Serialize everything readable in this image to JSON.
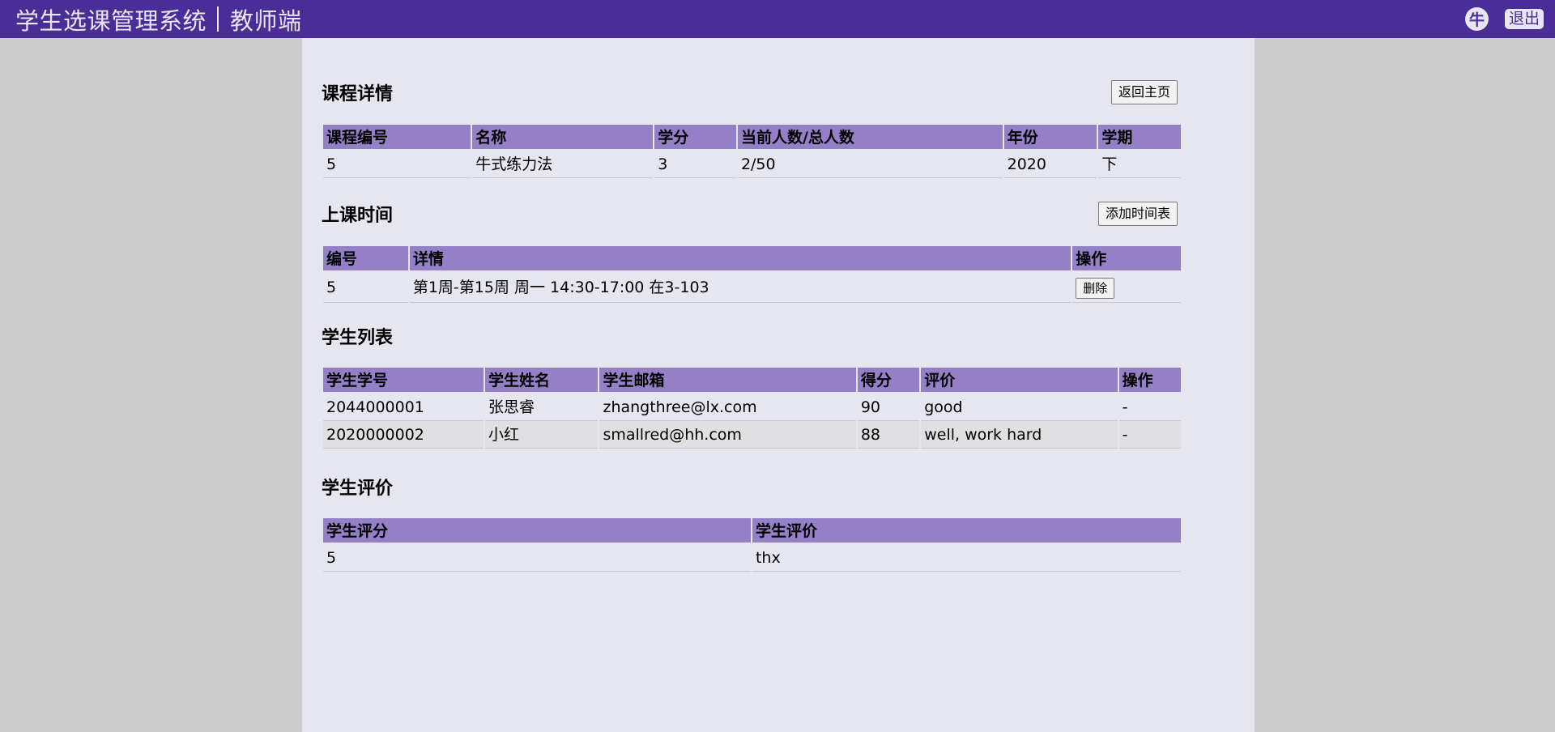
{
  "header": {
    "app_title": "学生选课管理系统",
    "role": "教师端",
    "avatar_char": "牛",
    "logout_label": "退出"
  },
  "course_detail": {
    "title": "课程详情",
    "back_button": "返回主页",
    "columns": [
      "课程编号",
      "名称",
      "学分",
      "当前人数/总人数",
      "年份",
      "学期"
    ],
    "row": [
      "5",
      "牛式练力法",
      "3",
      "2/50",
      "2020",
      "下"
    ]
  },
  "schedule": {
    "title": "上课时间",
    "add_button": "添加时间表",
    "columns": [
      "编号",
      "详情",
      "操作"
    ],
    "rows": [
      {
        "id": "5",
        "detail": "第1周-第15周 周一 14:30-17:00 在3-103",
        "action": "删除"
      }
    ]
  },
  "students": {
    "title": "学生列表",
    "columns": [
      "学生学号",
      "学生姓名",
      "学生邮箱",
      "得分",
      "评价",
      "操作"
    ],
    "rows": [
      [
        "2044000001",
        "张思睿",
        "zhangthree@lx.com",
        "90",
        "good",
        "-"
      ],
      [
        "2020000002",
        "小红",
        "smallred@hh.com",
        "88",
        "well, work hard",
        "-"
      ]
    ]
  },
  "evaluations": {
    "title": "学生评价",
    "columns": [
      "学生评分",
      "学生评价"
    ],
    "rows": [
      [
        "5",
        "thx"
      ]
    ]
  },
  "colors": {
    "header_bg": "#4a2d97",
    "table_header_bg": "#9580c8",
    "content_bg": "#e6e6f0",
    "page_bg": "#cccccc"
  }
}
